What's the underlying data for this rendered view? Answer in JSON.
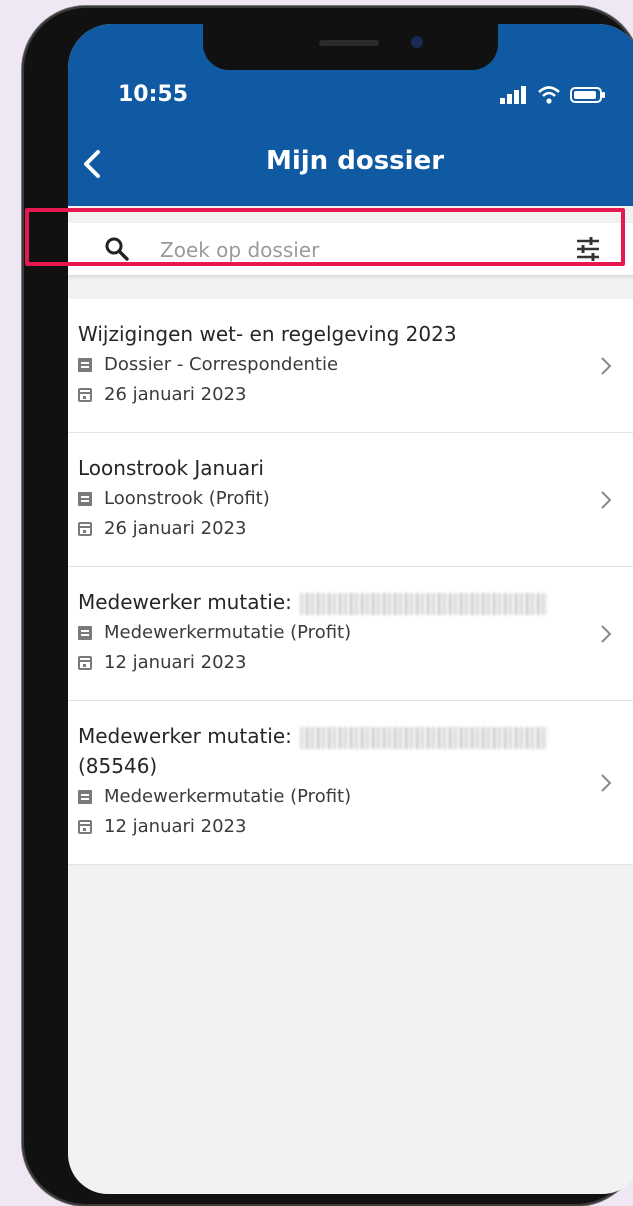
{
  "status_bar": {
    "time": "10:55"
  },
  "header": {
    "title": "Mijn dossier"
  },
  "search": {
    "placeholder": "Zoek op dossier"
  },
  "items": [
    {
      "title": "Wijzigingen wet- en regelgeving 2023",
      "type": "Dossier - Correspondentie",
      "date": "26 januari 2023"
    },
    {
      "title": "Loonstrook Januari",
      "type": "Loonstrook (Profit)",
      "date": "26 januari 2023"
    },
    {
      "title": "Medewerker mutatie:",
      "type": "Medewerkermutatie (Profit)",
      "date": "12 januari 2023"
    },
    {
      "title": "Medewerker mutatie:",
      "title_line2": "(85546)",
      "type": "Medewerkermutatie (Profit)",
      "date": "12 januari 2023"
    }
  ],
  "colors": {
    "appbar": "#0f5aa2",
    "highlight": "#e5194f",
    "background": "#efe7f3"
  }
}
